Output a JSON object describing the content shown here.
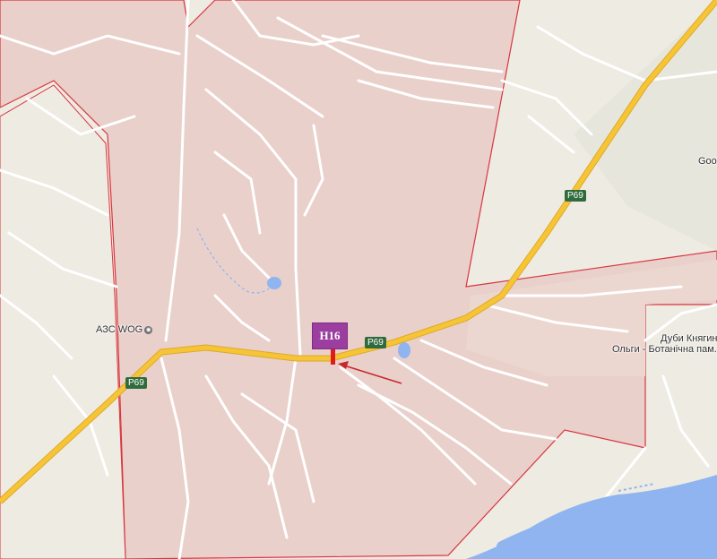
{
  "map": {
    "colors": {
      "land": "#eeebe3",
      "settlement_fill": "#e9d0cb",
      "boundary": "#d8363f",
      "highway": "#f6c536",
      "highway_casing": "#e0a82a",
      "local_road": "#ffffff",
      "water": "#8fb4f0",
      "marker_box": "#9b3ea0",
      "marker_stem": "#e01b1b",
      "arrow": "#c8282a",
      "shield_bg": "#2f6b3d"
    },
    "road_shields": [
      "P69",
      "P69",
      "P69"
    ],
    "poi_labels": {
      "gas_station": "АЗС WOG",
      "park_line1": "Дуби Княгині",
      "park_line2": "Ольги - Ботанічна пам...",
      "cutoff": "Goo"
    },
    "icons": {
      "gas_station": "fuel-pump-icon",
      "park": "camera-icon"
    },
    "marker": {
      "label": "H16"
    }
  }
}
